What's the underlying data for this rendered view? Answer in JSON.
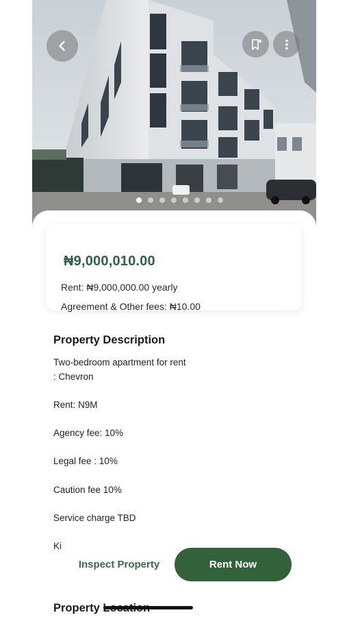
{
  "hero": {
    "image_alt": "apartment building photo",
    "dots_total": 8,
    "active_dot": 0,
    "icons": {
      "back": "chevron-left-icon",
      "bookmark": "bookmark-add-icon",
      "more": "more-vertical-icon"
    }
  },
  "price_card": {
    "price": "₦9,000,010.00",
    "rent": "Rent: ₦9,000,000.00 yearly",
    "fees": "Agreement & Other fees: ₦10.00"
  },
  "description": {
    "title": "Property Description",
    "lines": [
      "Two-bedroom apartment for rent",
      ": Chevron",
      "Rent: N9M",
      "Agency fee: 10%",
      "Legal fee : 10%",
      "Caution fee 10%",
      "Service charge TBD",
      "Ki"
    ]
  },
  "location": {
    "title": "Property Location"
  },
  "actions": {
    "inspect": "Inspect Property",
    "rent": "Rent Now"
  },
  "colors": {
    "accent": "#33623a",
    "price": "#2d6244"
  }
}
